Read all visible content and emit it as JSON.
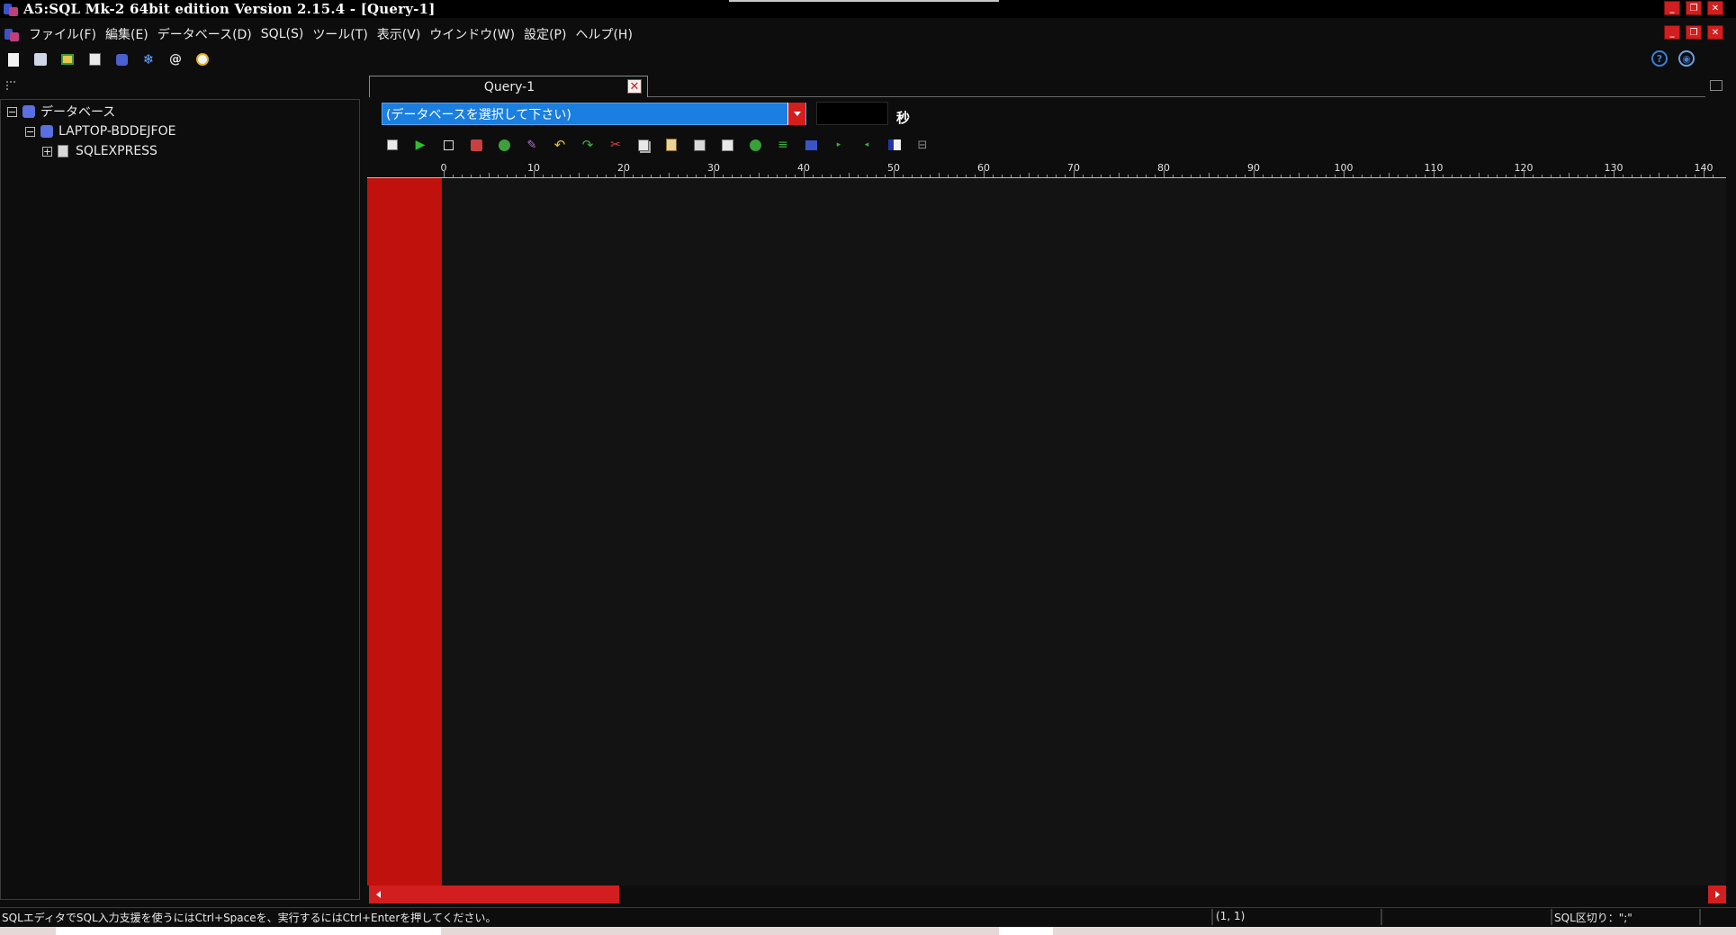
{
  "window": {
    "title": "A5:SQL Mk-2 64bit edition Version 2.15.4 - [Query-1]"
  },
  "menu": [
    {
      "label": "ファイル(F)"
    },
    {
      "label": "編集(E)"
    },
    {
      "label": "データベース(D)"
    },
    {
      "label": "SQL(S)"
    },
    {
      "label": "ツール(T)"
    },
    {
      "label": "表示(V)"
    },
    {
      "label": "ウインドウ(W)"
    },
    {
      "label": "設定(P)"
    },
    {
      "label": "ヘルプ(H)"
    }
  ],
  "tree": {
    "root": {
      "label": "データベース",
      "state": "expanded"
    },
    "server": {
      "label": "LAPTOP-BDDEJFOE",
      "state": "expanded"
    },
    "instance": {
      "label": "SQLEXPRESS",
      "state": "collapsed"
    }
  },
  "tab": {
    "label": "Query-1"
  },
  "db_select": {
    "value": "(データベースを選択して下さい)"
  },
  "timeout": {
    "value": "",
    "unit_label": "秒"
  },
  "ruler": {
    "labels": [
      "0",
      "10",
      "20",
      "30",
      "40",
      "50",
      "60",
      "70",
      "80",
      "90",
      "100",
      "110",
      "120",
      "130",
      "140"
    ]
  },
  "status": {
    "message": "SQLエディタでSQL入力支援を使うにはCtrl+Spaceを、実行するにはCtrl+Enterを押してください。",
    "cursor": "(1, 1)",
    "delimiter": "SQL区切り：\";\""
  },
  "colors": {
    "accent_red": "#d21e1e",
    "gutter_red": "#c0110c",
    "select_blue": "#1a7fe0",
    "background": "#0d0d0d"
  }
}
